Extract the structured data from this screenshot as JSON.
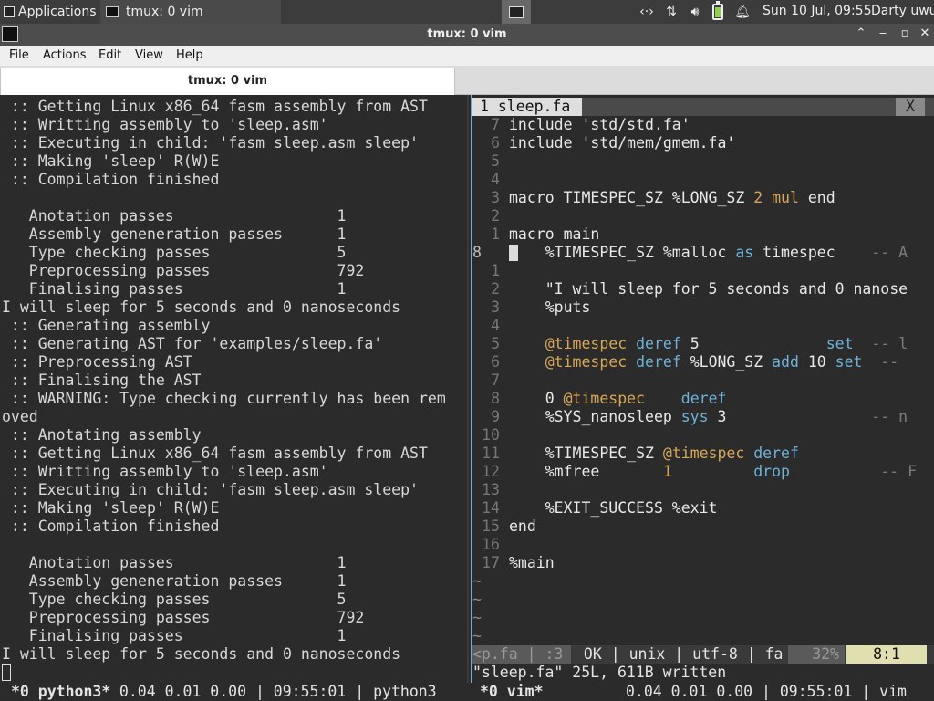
{
  "panel": {
    "applications_label": "Applications",
    "task_label": "tmux: 0 vim",
    "clock": "Sun 10 Jul, 09:55",
    "user": "Darty uwu",
    "icons": [
      "terminal-icon",
      "network-arrows-icon",
      "transfer-arrows-icon",
      "volume-icon",
      "battery-icon",
      "notification-bell-icon"
    ]
  },
  "window": {
    "title": "tmux: 0 vim",
    "menu": [
      "File",
      "Actions",
      "Edit",
      "View",
      "Help"
    ],
    "tab_title": "tmux: 0 vim"
  },
  "left_pane": {
    "lines": [
      " :: Getting Linux x86_64 fasm assembly from AST",
      " :: Writting assembly to 'sleep.asm'",
      " :: Executing in child: 'fasm sleep.asm sleep'",
      " :: Making 'sleep' R(W)E",
      " :: Compilation finished",
      "",
      "   Anotation passes                  1",
      "   Assembly geneneration passes      1",
      "   Type checking passes              5",
      "   Preprocessing passes              792",
      "   Finalising passes                 1",
      "I will sleep for 5 seconds and 0 nanoseconds",
      " :: Generating assembly",
      " :: Generating AST for 'examples/sleep.fa'",
      " :: Preprocessing AST",
      " :: Finalising the AST",
      " :: WARNING: Type checking currently has been rem",
      "oved",
      " :: Anotating assembly",
      " :: Getting Linux x86_64 fasm assembly from AST",
      " :: Writting assembly to 'sleep.asm'",
      " :: Executing in child: 'fasm sleep.asm sleep'",
      " :: Making 'sleep' R(W)E",
      " :: Compilation finished",
      "",
      "   Anotation passes                  1",
      "   Assembly geneneration passes      1",
      "   Type checking passes              5",
      "   Preprocessing passes              792",
      "   Finalising passes                 1",
      "I will sleep for 5 seconds and 0 nanoseconds"
    ]
  },
  "vim": {
    "tab_label": "1 sleep.fa",
    "close_label": "X",
    "lines": [
      {
        "ln": "7",
        "parts": [
          [
            "include 'std/std.fa'",
            "str"
          ]
        ]
      },
      {
        "ln": "6",
        "parts": [
          [
            "include 'std/mem/gmem.fa'",
            "str"
          ]
        ]
      },
      {
        "ln": "5",
        "parts": []
      },
      {
        "ln": "4",
        "parts": []
      },
      {
        "ln": "3",
        "parts": [
          [
            "macro TIMESPEC_SZ %LONG_SZ ",
            "str"
          ],
          [
            "2",
            "num"
          ],
          [
            " ",
            "str"
          ],
          [
            "mul",
            "num"
          ],
          [
            " end",
            "str"
          ]
        ]
      },
      {
        "ln": "2",
        "parts": []
      },
      {
        "ln": "1",
        "parts": [
          [
            "macro main",
            "str"
          ]
        ]
      },
      {
        "ln": "8",
        "cur": true,
        "parts": [
          [
            "    %TIMESPEC_SZ %malloc ",
            "str"
          ],
          [
            "as",
            "kw"
          ],
          [
            " timespec    ",
            "str"
          ],
          [
            "-- A",
            "cmt"
          ]
        ]
      },
      {
        "ln": "1",
        "parts": []
      },
      {
        "ln": "2",
        "parts": [
          [
            "    \"I will sleep for 5 seconds and 0 nanose",
            "str"
          ]
        ]
      },
      {
        "ln": "3",
        "parts": [
          [
            "    %puts",
            "str"
          ]
        ]
      },
      {
        "ln": "4",
        "parts": []
      },
      {
        "ln": "5",
        "parts": [
          [
            "    ",
            "str"
          ],
          [
            "@timespec",
            "num"
          ],
          [
            " ",
            "str"
          ],
          [
            "deref",
            "kw"
          ],
          [
            " 5              ",
            "str"
          ],
          [
            "set",
            "kw"
          ],
          [
            "  ",
            "str"
          ],
          [
            "-- l",
            "cmt"
          ]
        ]
      },
      {
        "ln": "6",
        "parts": [
          [
            "    ",
            "str"
          ],
          [
            "@timespec",
            "num"
          ],
          [
            " ",
            "str"
          ],
          [
            "deref",
            "kw"
          ],
          [
            " %LONG_SZ ",
            "str"
          ],
          [
            "add",
            "kw"
          ],
          [
            " 10 ",
            "str"
          ],
          [
            "set",
            "kw"
          ],
          [
            "  ",
            "str"
          ],
          [
            "-- ",
            "cmt"
          ]
        ]
      },
      {
        "ln": "7",
        "parts": []
      },
      {
        "ln": "8",
        "parts": [
          [
            "    0 ",
            "str"
          ],
          [
            "@timespec",
            "num"
          ],
          [
            "    ",
            "str"
          ],
          [
            "deref",
            "kw"
          ]
        ]
      },
      {
        "ln": "9",
        "parts": [
          [
            "    %SYS_nanosleep ",
            "str"
          ],
          [
            "sys",
            "kw"
          ],
          [
            " 3                ",
            "str"
          ],
          [
            "-- n",
            "cmt"
          ]
        ]
      },
      {
        "ln": "10",
        "parts": []
      },
      {
        "ln": "11",
        "parts": [
          [
            "    %TIMESPEC_SZ ",
            "str"
          ],
          [
            "@timespec",
            "num"
          ],
          [
            " ",
            "str"
          ],
          [
            "deref",
            "kw"
          ]
        ]
      },
      {
        "ln": "12",
        "parts": [
          [
            "    %mfree       ",
            "str"
          ],
          [
            "1",
            "num"
          ],
          [
            "         ",
            "str"
          ],
          [
            "drop",
            "kw"
          ],
          [
            "          ",
            "str"
          ],
          [
            "-- F",
            "cmt"
          ]
        ]
      },
      {
        "ln": "13",
        "parts": []
      },
      {
        "ln": "14",
        "parts": [
          [
            "    %EXIT_SUCCESS %exit",
            "str"
          ]
        ]
      },
      {
        "ln": "15",
        "parts": [
          [
            "end",
            "str"
          ]
        ]
      },
      {
        "ln": "16",
        "parts": []
      },
      {
        "ln": "17",
        "parts": [
          [
            "%main",
            "str"
          ]
        ]
      }
    ],
    "tildes": [
      "~",
      "~",
      "~",
      "~"
    ],
    "status_file": "<p.fa | :3",
    "status_info": " OK | unix | utf-8 | fa",
    "status_pct": "32%",
    "status_pos": "8:1",
    "message": "\"sleep.fa\" 25L, 611B written"
  },
  "tmux": {
    "left_window": "*0 python3*",
    "left_stats": " 0.04 0.01 0.00 | 09:55:01 | python3",
    "right_window": "*0 vim*",
    "right_stats": "0.04 0.01 0.00 | 09:55:01 | vim"
  }
}
